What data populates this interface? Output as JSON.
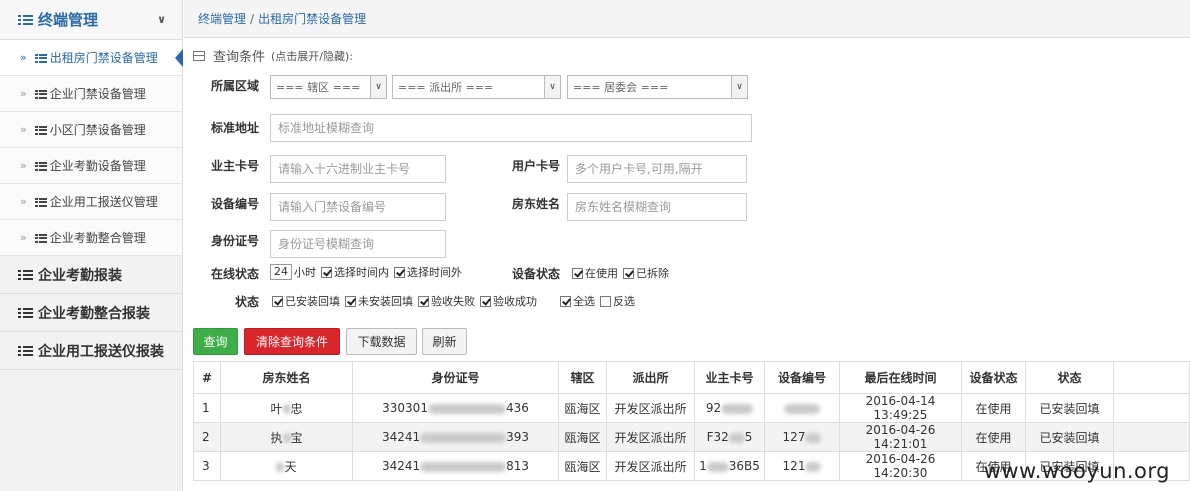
{
  "sidebar": {
    "header": "终端管理",
    "sub_items": [
      {
        "label": "出租房门禁设备管理",
        "active": true
      },
      {
        "label": "企业门禁设备管理"
      },
      {
        "label": "小区门禁设备管理"
      },
      {
        "label": "企业考勤设备管理"
      },
      {
        "label": "企业用工报送仪管理"
      },
      {
        "label": "企业考勤整合管理"
      }
    ],
    "top_items": [
      "企业考勤报装",
      "企业考勤整合报装",
      "企业用工报送仪报装"
    ]
  },
  "breadcrumb": {
    "root": "终端管理",
    "sep": "/",
    "current": "出租房门禁设备管理"
  },
  "query": {
    "title": "查询条件",
    "hint": "(点击展开/隐藏):",
    "region_label": "所属区域",
    "district_select": "=== 辖区 ===",
    "station_select": "=== 派出所 ===",
    "committee_select": "=== 居委会 ===",
    "address_label": "标准地址",
    "address_placeholder": "标准地址模糊查询",
    "owner_card_label": "业主卡号",
    "owner_card_placeholder": "请输入十六进制业主卡号",
    "user_card_label": "用户卡号",
    "user_card_placeholder": "多个用户卡号,可用,隔开",
    "device_no_label": "设备编号",
    "device_no_placeholder": "请输入门禁设备编号",
    "landlord_label": "房东姓名",
    "landlord_placeholder": "房东姓名模糊查询",
    "id_label": "身份证号",
    "id_placeholder": "身份证号模糊查询",
    "online_label": "在线状态",
    "online_hours": "24",
    "hours_unit": "小时",
    "within_label": "选择时间内",
    "outside_label": "选择时间外",
    "device_status_label": "设备状态",
    "in_use_label": "在使用",
    "removed_label": "已拆除",
    "status_label": "状态",
    "status_opts": [
      "已安装回填",
      "未安装回填",
      "验收失败",
      "验收成功"
    ],
    "select_all_label": "全选",
    "invert_label": "反选"
  },
  "buttons": {
    "query": "查询",
    "clear": "清除查询条件",
    "download": "下载数据",
    "refresh": "刷新"
  },
  "table": {
    "headers": [
      "#",
      "房东姓名",
      "身份证号",
      "辖区",
      "派出所",
      "业主卡号",
      "设备编号",
      "最后在线时间",
      "设备状态",
      "状态"
    ],
    "rows": [
      {
        "idx": "1",
        "name_a": "叶",
        "name_b": "忠",
        "id_a": "330301",
        "id_b": "436",
        "district": "瓯海区",
        "station": "开发区派出所",
        "card_a": "92",
        "card_b": "",
        "device_a": "",
        "time": "2016-04-14 13:49:25",
        "dstatus": "在使用",
        "status": "已安装回填"
      },
      {
        "idx": "2",
        "name_a": "执",
        "name_b": "宝",
        "id_a": "34241",
        "id_b": "393",
        "district": "瓯海区",
        "station": "开发区派出所",
        "card_a": "F32",
        "card_b": "5",
        "device_a": "127",
        "time": "2016-04-26 14:21:01",
        "dstatus": "在使用",
        "status": "已安装回填"
      },
      {
        "idx": "3",
        "name_a": "",
        "name_b": "天",
        "id_a": "34241",
        "id_b": "813",
        "district": "瓯海区",
        "station": "开发区派出所",
        "card_a": "1",
        "card_b": "36B5",
        "device_a": "121",
        "time": "2016-04-26 14:20:30",
        "dstatus": "在使用",
        "status": "已安装回填"
      }
    ]
  },
  "watermark": "www.wooyun.org"
}
